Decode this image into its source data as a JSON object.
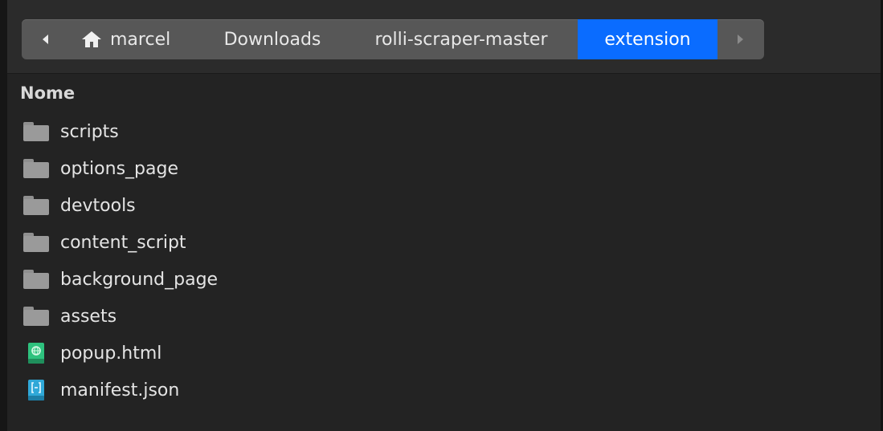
{
  "pathbar": {
    "crumbs": [
      "marcel",
      "Downloads",
      "rolli-scraper-master",
      "extension"
    ],
    "active_index": 3
  },
  "list": {
    "header": "Nome",
    "items": [
      {
        "label": "scripts",
        "type": "folder"
      },
      {
        "label": "options_page",
        "type": "folder"
      },
      {
        "label": "devtools",
        "type": "folder"
      },
      {
        "label": "content_script",
        "type": "folder"
      },
      {
        "label": "background_page",
        "type": "folder"
      },
      {
        "label": "assets",
        "type": "folder"
      },
      {
        "label": "popup.html",
        "type": "html-file"
      },
      {
        "label": "manifest.json",
        "type": "json-file"
      }
    ]
  },
  "colors": {
    "accent": "#0a6cff",
    "html_icon": "#2ec27e",
    "json_icon": "#2fa8d8"
  }
}
